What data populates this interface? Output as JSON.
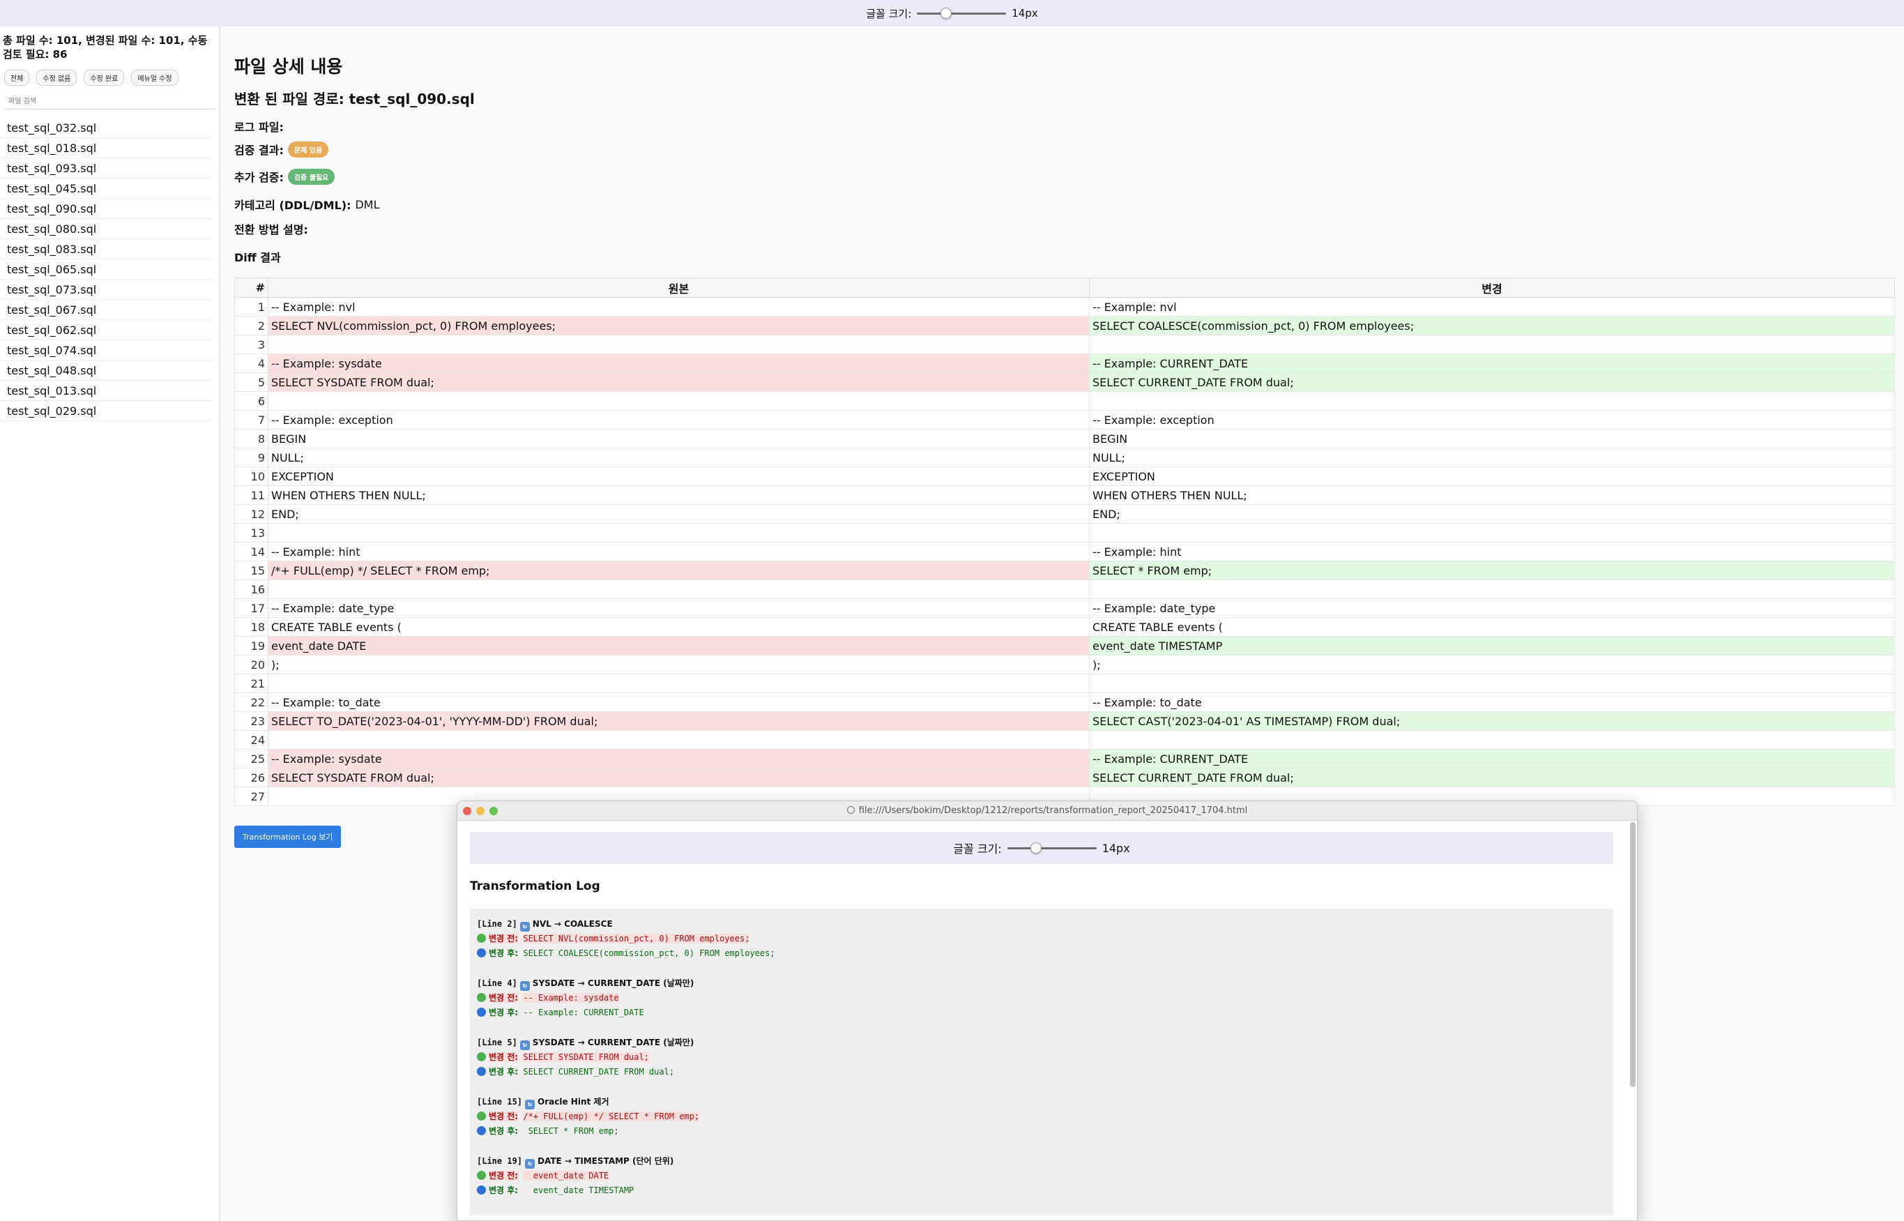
{
  "font_control": {
    "label": "글꼴 크기:",
    "value": "14px",
    "level": 0.3
  },
  "sidebar": {
    "summary": "총 파일 수: 101, 변경된 파일 수: 101, 수동 검토 필요: 86",
    "filters": [
      "전체",
      "수정 없음",
      "수정 완료",
      "메뉴얼 수정"
    ],
    "search_placeholder": "파일 검색",
    "files": [
      "test_sql_032.sql",
      "test_sql_018.sql",
      "test_sql_093.sql",
      "test_sql_045.sql",
      "test_sql_090.sql",
      "test_sql_080.sql",
      "test_sql_083.sql",
      "test_sql_065.sql",
      "test_sql_073.sql",
      "test_sql_067.sql",
      "test_sql_062.sql",
      "test_sql_074.sql",
      "test_sql_048.sql",
      "test_sql_013.sql",
      "test_sql_029.sql"
    ]
  },
  "main": {
    "title": "파일 상세 내용",
    "path_label": "변환 된 파일 경로: test_sql_090.sql",
    "log_file_label": "로그 파일:",
    "validation_label": "검증 결과:",
    "validation_badge": "문제 있음",
    "extra_label": "추가 검증:",
    "extra_badge": "검증 불필요",
    "category_label": "카테고리 (DDL/DML):",
    "category_value": "DML",
    "method_label": "전환 방법 설명:",
    "diff_label": "Diff 결과",
    "diff_headers": [
      "#",
      "원본",
      "변경"
    ],
    "diff_rows": [
      {
        "n": "1",
        "o": "-- Example: nvl",
        "m": "-- Example: nvl",
        "c": false
      },
      {
        "n": "2",
        "o": "SELECT NVL(commission_pct, 0) FROM employees;",
        "m": "SELECT COALESCE(commission_pct, 0) FROM employees;",
        "c": true
      },
      {
        "n": "3",
        "o": "",
        "m": "",
        "c": false
      },
      {
        "n": "4",
        "o": "-- Example: sysdate",
        "m": "-- Example: CURRENT_DATE",
        "c": true
      },
      {
        "n": "5",
        "o": "SELECT SYSDATE FROM dual;",
        "m": "SELECT CURRENT_DATE FROM dual;",
        "c": true
      },
      {
        "n": "6",
        "o": "",
        "m": "",
        "c": false
      },
      {
        "n": "7",
        "o": "-- Example: exception",
        "m": "-- Example: exception",
        "c": false
      },
      {
        "n": "8",
        "o": "BEGIN",
        "m": "BEGIN",
        "c": false
      },
      {
        "n": "9",
        "o": "NULL;",
        "m": "NULL;",
        "c": false
      },
      {
        "n": "10",
        "o": "EXCEPTION",
        "m": "EXCEPTION",
        "c": false
      },
      {
        "n": "11",
        "o": "WHEN OTHERS THEN NULL;",
        "m": "WHEN OTHERS THEN NULL;",
        "c": false
      },
      {
        "n": "12",
        "o": "END;",
        "m": "END;",
        "c": false
      },
      {
        "n": "13",
        "o": "",
        "m": "",
        "c": false
      },
      {
        "n": "14",
        "o": "-- Example: hint",
        "m": "-- Example: hint",
        "c": false
      },
      {
        "n": "15",
        "o": "/*+ FULL(emp) */ SELECT * FROM emp;",
        "m": "SELECT * FROM emp;",
        "c": true
      },
      {
        "n": "16",
        "o": "",
        "m": "",
        "c": false
      },
      {
        "n": "17",
        "o": "-- Example: date_type",
        "m": "-- Example: date_type",
        "c": false
      },
      {
        "n": "18",
        "o": "CREATE TABLE events (",
        "m": "CREATE TABLE events (",
        "c": false
      },
      {
        "n": "19",
        "o": "event_date DATE",
        "m": "event_date TIMESTAMP",
        "c": true
      },
      {
        "n": "20",
        "o": ");",
        "m": ");",
        "c": false
      },
      {
        "n": "21",
        "o": "",
        "m": "",
        "c": false
      },
      {
        "n": "22",
        "o": "-- Example: to_date",
        "m": "-- Example: to_date",
        "c": false
      },
      {
        "n": "23",
        "o": "SELECT TO_DATE('2023-04-01', 'YYYY-MM-DD') FROM dual;",
        "m": "SELECT CAST('2023-04-01' AS TIMESTAMP) FROM dual;",
        "c": true
      },
      {
        "n": "24",
        "o": "",
        "m": "",
        "c": false
      },
      {
        "n": "25",
        "o": "-- Example: sysdate",
        "m": "-- Example: CURRENT_DATE",
        "c": true
      },
      {
        "n": "26",
        "o": "SELECT SYSDATE FROM dual;",
        "m": "SELECT CURRENT_DATE FROM dual;",
        "c": true
      },
      {
        "n": "27",
        "o": "",
        "m": "",
        "c": false
      }
    ],
    "log_button": "Transformation Log 보기"
  },
  "popup": {
    "url": "file:///Users/bokim/Desktop/1212/reports/transformation_report_20250417_1704.html",
    "title": "Transformation Log",
    "before_label": "변경 전:",
    "after_label": "변경 후:",
    "entries": [
      {
        "head": "[Line 2]",
        "rule": "NVL → COALESCE",
        "before": "SELECT NVL(commission_pct, 0) FROM employees;",
        "after": "SELECT COALESCE(commission_pct, 0) FROM employees;"
      },
      {
        "head": "[Line 4]",
        "rule": "SYSDATE → CURRENT_DATE (날짜만)",
        "before": "-- Example: sysdate",
        "after": "-- Example: CURRENT_DATE"
      },
      {
        "head": "[Line 5]",
        "rule": "SYSDATE → CURRENT_DATE (날짜만)",
        "before": "SELECT SYSDATE FROM dual;",
        "after": "SELECT CURRENT_DATE FROM dual;"
      },
      {
        "head": "[Line 15]",
        "rule": "Oracle Hint 제거",
        "before": "/*+ FULL(emp) */ SELECT * FROM emp;",
        "after": " SELECT * FROM emp;"
      },
      {
        "head": "[Line 19]",
        "rule": "DATE → TIMESTAMP (단어 단위)",
        "before": "  event_date DATE",
        "after": "  event_date TIMESTAMP"
      }
    ]
  },
  "colors": {
    "accent": "#2f7de1",
    "removed_bg": "#f9dfdf",
    "added_bg": "#e3f8e1",
    "badge_warning": "#e8ab55",
    "badge_ok": "#63b673"
  }
}
